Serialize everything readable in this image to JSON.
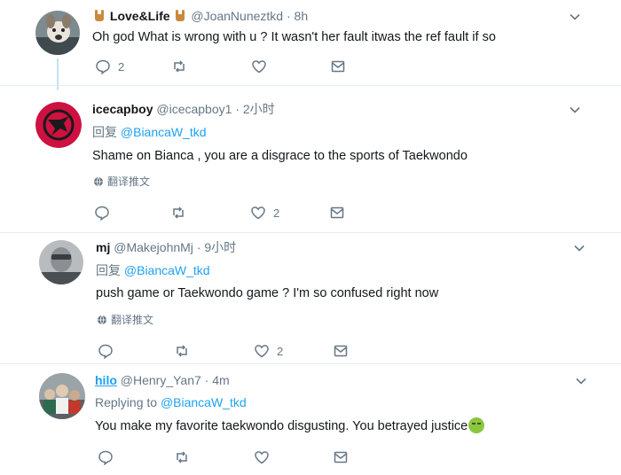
{
  "tweets": [
    {
      "display_name": "Love&Life",
      "handle": "@JoanNuneztkd",
      "dot": "·",
      "time": "8h",
      "text": "Oh god What is wrong with u ? It wasn't her fault itwas the ref fault if so",
      "reply_count": "2",
      "like_count": "",
      "icons": {
        "avatar": "avatar-dog-photo",
        "name_decoration": "rock-hand-emoji"
      }
    },
    {
      "display_name": "icecapboy",
      "handle": "@icecapboy1",
      "dot": "·",
      "time": "2小时",
      "reply_prefix": "回复",
      "reply_to": "@BiancaW_tkd",
      "text": "Shame on Bianca , you are a disgrace to the sports of Taekwondo",
      "translate": "翻译推文",
      "reply_count": "",
      "like_count": "2",
      "icons": {
        "avatar": "raptors-logo",
        "translate": "globe-icon"
      },
      "colors": {
        "avatar_bg": "#ce1141"
      }
    },
    {
      "display_name": "mj",
      "handle": "@MakejohnMj",
      "dot": "·",
      "time": "9小时",
      "reply_prefix": "回复",
      "reply_to": "@BiancaW_tkd",
      "text": "push game or Taekwondo game ? I'm so confused right now",
      "translate": "翻译推文",
      "reply_count": "",
      "like_count": "2",
      "icons": {
        "avatar": "avatar-person-photo",
        "translate": "globe-icon"
      }
    },
    {
      "display_name": "hilo",
      "handle": "@Henry_Yan7",
      "dot": "·",
      "time": "4m",
      "reply_prefix": "Replying to",
      "reply_to": "@BiancaW_tkd",
      "text": "You make my favorite taekwondo disgusting. You betrayed justice",
      "reply_count": "",
      "like_count": "",
      "icons": {
        "avatar": "avatar-crowd-photo",
        "trailing_emoji": "nauseated-face-emoji"
      }
    }
  ],
  "colors": {
    "link": "#1da1f2",
    "muted": "#657786",
    "separator": "#e6ecf0",
    "thread_line": "#c4e1f5"
  }
}
